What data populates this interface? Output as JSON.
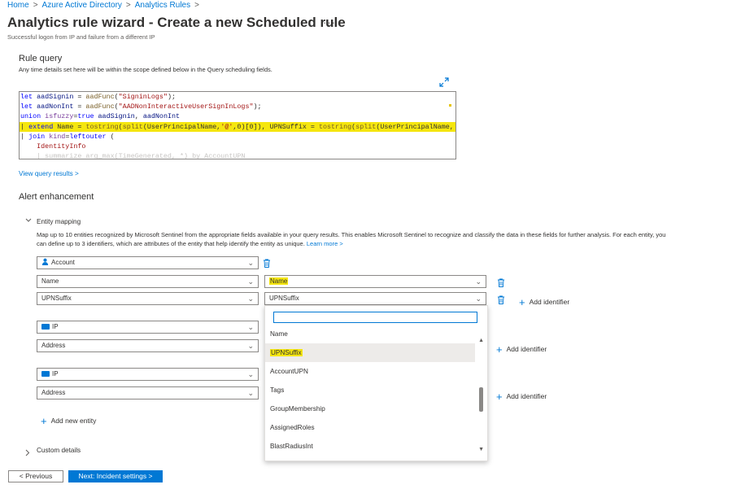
{
  "breadcrumb": [
    "Home",
    "Azure Active Directory",
    "Analytics Rules"
  ],
  "page": {
    "title": "Analytics rule wizard - Create a new Scheduled rule",
    "more": "···",
    "subtitle": "Successful logon from IP and failure from a different IP"
  },
  "rule_query": {
    "heading": "Rule query",
    "description": "Any time details set here will be within the scope defined below in the Query scheduling fields.",
    "view_results_link": "View query results >"
  },
  "alert_enhancement": {
    "heading": "Alert enhancement",
    "entity_mapping": {
      "label": "Entity mapping",
      "description_line1": "Map up to 10 entities recognized by Microsoft Sentinel from the appropriate fields available in your query results. This enables Microsoft Sentinel to recognize and classify the data in these fields for further analysis. For each entity, you",
      "description_line2": "can define up to 3 identifiers, which are attributes of the entity that help identify the entity as unique.",
      "learn_more": "Learn more >",
      "entities": [
        {
          "type": "Account",
          "identifiers": [
            {
              "field": "Name",
              "value": "Name"
            },
            {
              "field": "UPNSuffix",
              "value": "UPNSuffix"
            }
          ]
        },
        {
          "type": "IP",
          "identifiers": [
            {
              "field": "Address"
            }
          ]
        },
        {
          "type": "IP",
          "identifiers": [
            {
              "field": "Address"
            }
          ]
        }
      ],
      "add_identifier": "Add identifier",
      "add_new_entity": "Add new entity"
    },
    "custom_details": "Custom details"
  },
  "dropdown": {
    "search_value": "",
    "options": [
      "Name",
      "UPNSuffix",
      "AccountUPN",
      "Tags",
      "GroupMembership",
      "AssignedRoles",
      "BlastRadiusInt"
    ],
    "selected": "UPNSuffix"
  },
  "footer": {
    "previous": "< Previous",
    "next": "Next: Incident settings >"
  },
  "colors": {
    "accent": "#0078d4",
    "highlight": "#f5e60f"
  }
}
